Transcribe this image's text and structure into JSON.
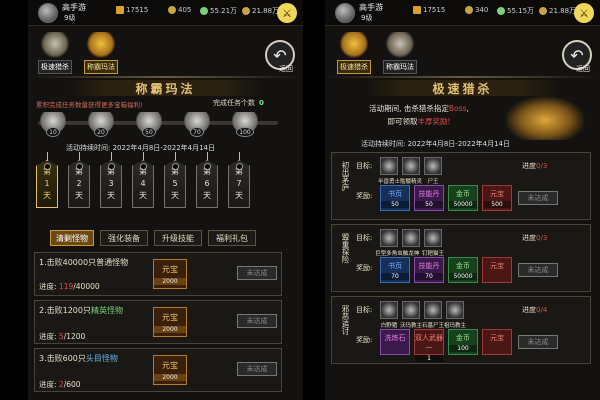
{
  "left": {
    "user": {
      "name": "高手游",
      "level": "9级"
    },
    "resources": [
      "17515",
      "405",
      "55.21万",
      "21.88万"
    ],
    "nav": [
      {
        "label": "极速猎杀",
        "active": false
      },
      {
        "label": "称霸玛法",
        "active": true
      }
    ],
    "back_label": "返回",
    "title": "称霸玛法",
    "subtitle": "累积完成任务数量获得更多宝箱福利!",
    "tasks_done_label": "完成任务个数",
    "tasks_done": "0",
    "chests": [
      "10",
      "20",
      "50",
      "70",
      "100"
    ],
    "progress": 0,
    "time_label": "活动持续时间: 2022年4月8日-2022年4月14日",
    "days": [
      {
        "c1": "第",
        "c2": "1",
        "c3": "天",
        "active": true
      },
      {
        "c1": "第",
        "c2": "2",
        "c3": "天",
        "active": false
      },
      {
        "c1": "第",
        "c2": "3",
        "c3": "天",
        "active": false
      },
      {
        "c1": "第",
        "c2": "4",
        "c3": "天",
        "active": false
      },
      {
        "c1": "第",
        "c2": "5",
        "c3": "天",
        "active": false
      },
      {
        "c1": "第",
        "c2": "6",
        "c3": "天",
        "active": false
      },
      {
        "c1": "第",
        "c2": "7",
        "c3": "天",
        "active": false
      }
    ],
    "tabs": [
      {
        "label": "清剿怪物",
        "active": true
      },
      {
        "label": "强化装备",
        "active": false
      },
      {
        "label": "升级技能",
        "active": false
      },
      {
        "label": "福利礼包",
        "active": false
      }
    ],
    "tasks": [
      {
        "pre": "1.击败40000只普通怪物",
        "hl": "",
        "post": "",
        "prog_label": "进度: ",
        "done": "119",
        "total": "/40000",
        "reward": "元宝",
        "reward_num": "2000",
        "status": "未达成"
      },
      {
        "pre": "2.击败1200只",
        "hl": "精英怪物",
        "hlcolor": "g",
        "post": "",
        "prog_label": "进度: ",
        "done": "5",
        "total": "/1200",
        "reward": "元宝",
        "reward_num": "2000",
        "status": "未达成"
      },
      {
        "pre": "3.击败600只",
        "hl": "头目怪物",
        "hlcolor": "c",
        "post": "",
        "prog_label": "进度: ",
        "done": "2",
        "total": "/600",
        "reward": "元宝",
        "reward_num": "2000",
        "status": "未达成"
      }
    ]
  },
  "right": {
    "user": {
      "name": "高手游",
      "level": "9级"
    },
    "resources": [
      "17515",
      "340",
      "55.15万",
      "21.88万"
    ],
    "nav": [
      {
        "label": "极速猎杀",
        "active": true
      },
      {
        "label": "称霸玛法",
        "active": false
      }
    ],
    "back_label": "返回",
    "title": "极速猎杀",
    "desc1_pre": "活动期间, 击杀猎杀指定",
    "desc1_boss": "Boss",
    "desc1_post": ",",
    "desc2_pre": "即可领取",
    "desc2_hl": "丰厚奖励!",
    "time_label": "活动持续时间: 2022年4月8日-2022年4月14日",
    "target_label": "目标:",
    "reward_label": "奖励:",
    "progress_label": "进度",
    "hunts": [
      {
        "side": "初出茅庐",
        "monsters": [
          "半兽勇士",
          "骷髅精灵",
          "尸王"
        ],
        "done": "0",
        "total": "/3",
        "rewards": [
          {
            "name": "书页",
            "num": "50",
            "style": "blue"
          },
          {
            "name": "技能丹",
            "num": "50",
            "style": "purp"
          },
          {
            "name": "金币",
            "num": "50000",
            "style": "green"
          },
          {
            "name": "元宝",
            "num": "500",
            "style": "red"
          }
        ],
        "status": "未达成"
      },
      {
        "side": "盟重探险",
        "monsters": [
          "巨型多角虫",
          "触龙神",
          "钉耙猫王"
        ],
        "done": "0",
        "total": "/3",
        "rewards": [
          {
            "name": "书页",
            "num": "70",
            "style": "blue"
          },
          {
            "name": "技能丹",
            "num": "70",
            "style": "purp"
          },
          {
            "name": "金币",
            "num": "50000",
            "style": "green"
          },
          {
            "name": "元宝",
            "num": "",
            "style": "red"
          }
        ],
        "status": "未达成"
      },
      {
        "side": "邪恶追讨",
        "monsters": [
          "白野猪",
          "沃玛教主",
          "石墓尸王",
          "祖玛教主"
        ],
        "done": "0",
        "total": "/4",
        "rewards": [
          {
            "name": "洗炼石",
            "num": "",
            "style": "purp"
          },
          {
            "name": "双人武器一",
            "num": "1",
            "style": "red"
          },
          {
            "name": "金币",
            "num": "100",
            "style": "green"
          },
          {
            "name": "元宝",
            "num": "",
            "style": "red"
          }
        ],
        "status": "未达成"
      }
    ]
  }
}
